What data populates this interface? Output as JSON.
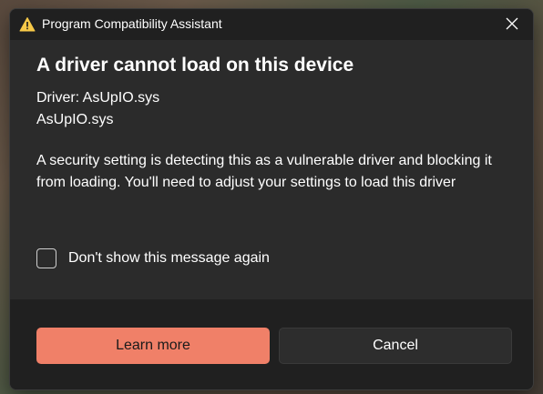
{
  "window": {
    "title": "Program Compatibility Assistant",
    "icon": "warning-icon",
    "close_icon": "close-icon"
  },
  "content": {
    "heading": "A driver cannot load on this device",
    "driver_line": "Driver: AsUpIO.sys",
    "driver_file": "AsUpIO.sys",
    "message": "A security setting is detecting this as a vulnerable driver and blocking it from loading. You'll need to adjust your settings to load this driver",
    "checkbox_label": "Don't show this message again",
    "checkbox_checked": false
  },
  "buttons": {
    "primary_label": "Learn more",
    "secondary_label": "Cancel"
  },
  "colors": {
    "accent": "#f08068",
    "warning": "#f7c948",
    "dialog_bg": "#2b2b2b",
    "titlebar_bg": "#202020"
  }
}
